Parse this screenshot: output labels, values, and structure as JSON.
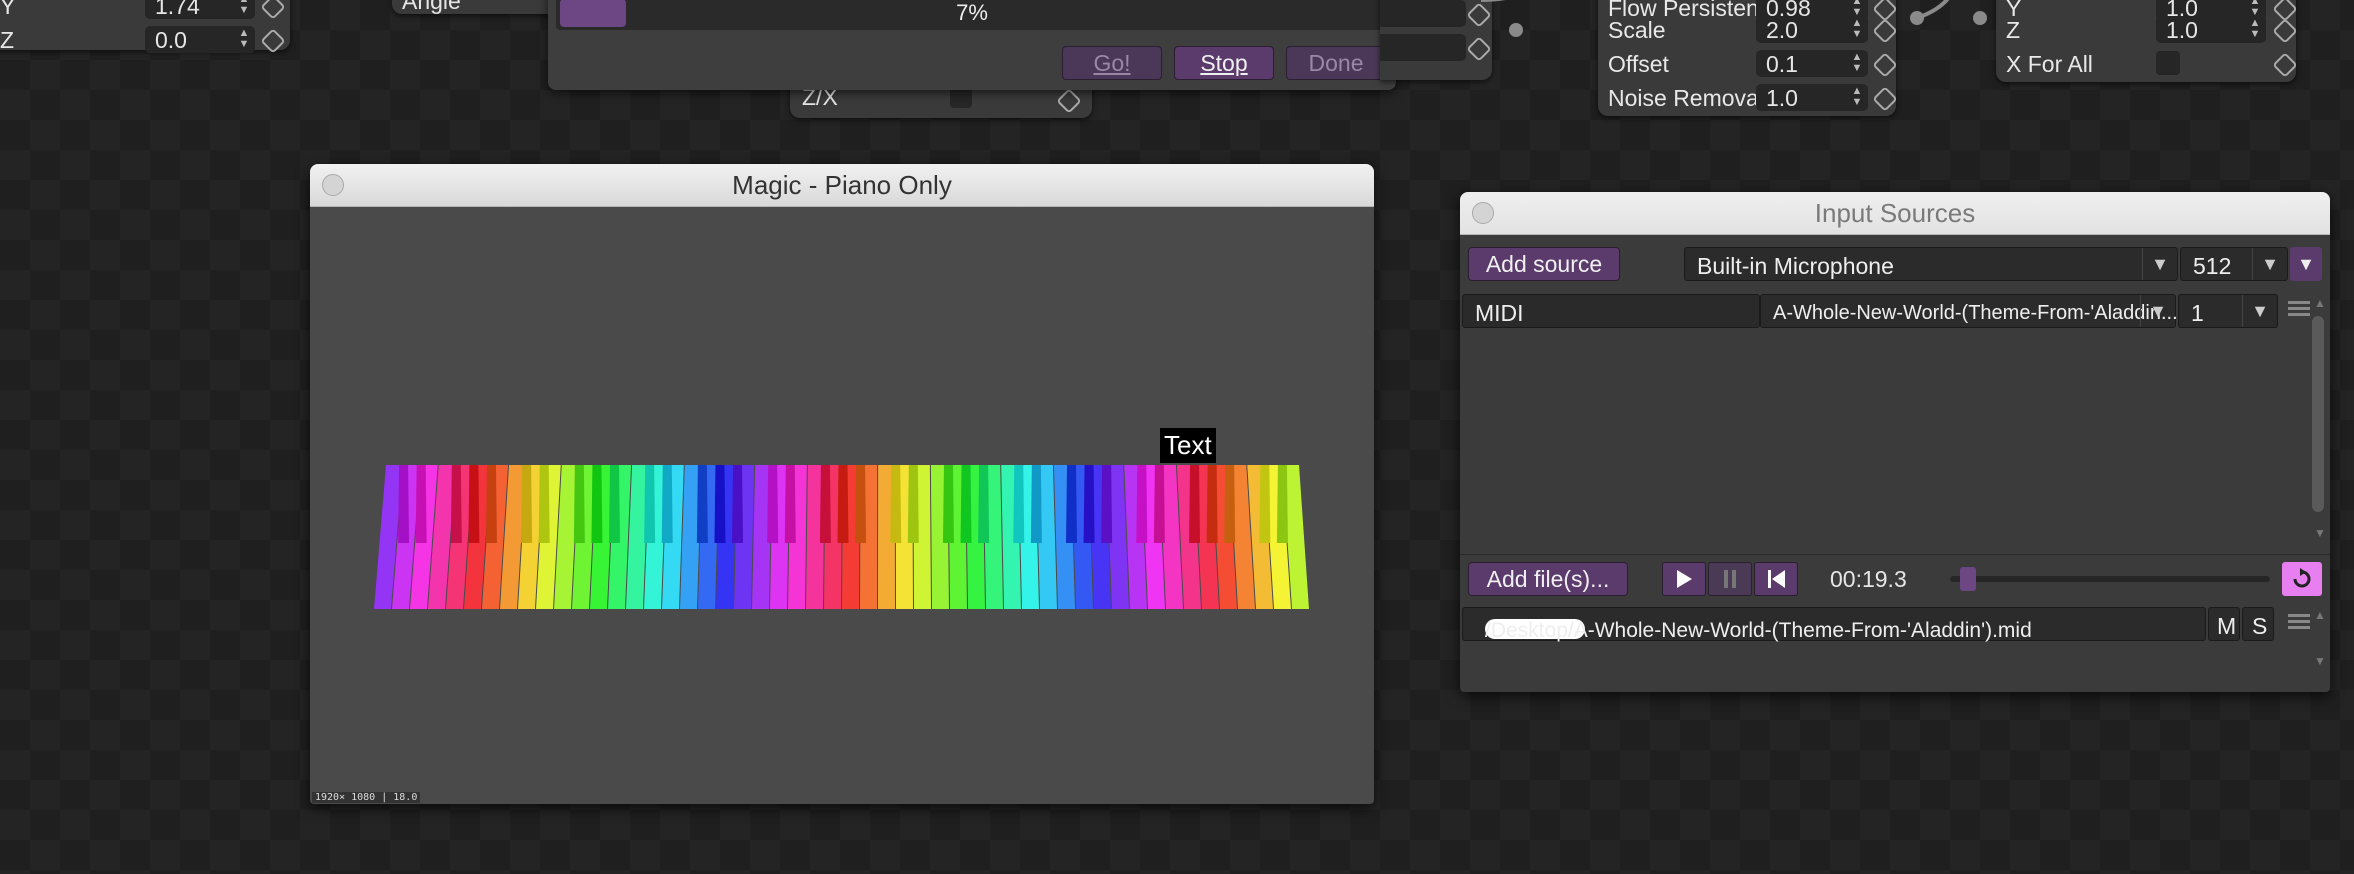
{
  "left_node": {
    "rows": [
      {
        "label": "Y",
        "value": "1.74"
      },
      {
        "label": "Z",
        "value": "0.0"
      }
    ]
  },
  "angle_node": {
    "label": "Angle"
  },
  "progress_dialog": {
    "percent": "7%",
    "progress": 0.07,
    "go_label": "Go!",
    "stop_label": "Stop",
    "done_label": "Done"
  },
  "zx_node": {
    "label": "Z/X"
  },
  "noise_node": {
    "rows": [
      {
        "label": "Flow Persistence",
        "value": "0.98"
      },
      {
        "label": "Scale",
        "value": "2.0"
      },
      {
        "label": "Offset",
        "value": "0.1"
      },
      {
        "label": "Noise Removal",
        "value": "1.0"
      }
    ]
  },
  "scale_node": {
    "rows": [
      {
        "label": "Y",
        "value": "1.0"
      },
      {
        "label": "Z",
        "value": "1.0"
      }
    ],
    "xforall_label": "X For All"
  },
  "magic_window": {
    "title": "Magic - Piano Only",
    "text_overlay": "Text",
    "status": "1920× 1080 | 18.0"
  },
  "input_sources": {
    "title": "Input Sources",
    "add_source_label": "Add source",
    "device": "Built-in Microphone",
    "buffer_size": "512",
    "midi_name": "MIDI",
    "midi_track": "A-Whole-New-World-(Theme-From-'Aladdin...",
    "midi_channel": "1",
    "add_files_label": "Add file(s)...",
    "time": "00:19.3",
    "file_path_prefix": "/Users/",
    "file_path_suffix": "/Desktop/A-Whole-New-World-(Theme-From-'Aladdin').mid",
    "mute_label": "M",
    "solo_label": "S"
  },
  "colors": {
    "accent": "#5b3a6c",
    "loop_pink": "#e77ff0"
  }
}
